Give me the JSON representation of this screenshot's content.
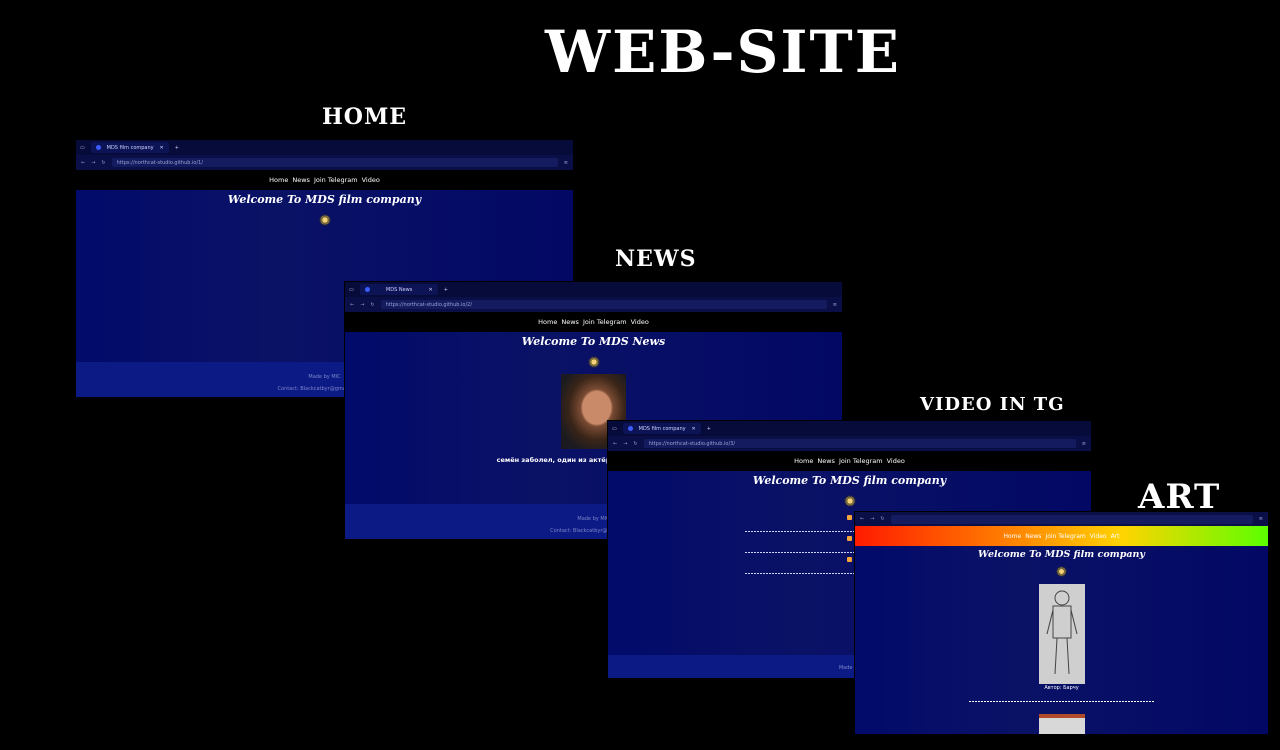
{
  "headings": {
    "main": "WEB-SITE",
    "home": "HOME",
    "news": "NEWS",
    "video": "VIDEO IN TG",
    "art": "ART"
  },
  "nav": [
    "Home",
    "News",
    "Join Telegram",
    "Video"
  ],
  "art_nav": [
    "Home",
    "News",
    "Join Telegram",
    "Video",
    "Art"
  ],
  "home_shot": {
    "tab_title": "MDS film company",
    "url": "https://northcat-studio.github.io/1/",
    "welcome": "Welcome To MDS film company",
    "footer_line1": "Made by MIC",
    "footer_line2": "Contact: Blackcatbyr@gmail.com | MI"
  },
  "news_shot": {
    "tab_title": "MDS News",
    "url": "https://northcat-studio.github.io/2/",
    "welcome": "Welcome To MDS News",
    "post_text": "семён заболел, один из актёров! 😷 Желаем выздо",
    "footer_line1": "Made by MIC",
    "footer_line2": "Contact: Blackcatbyr@gmail.com |"
  },
  "video_shot": {
    "tab_title": "MDS film company",
    "url": "https://northcat-studio.github.io/3/",
    "welcome": "Welcome To MDS film company",
    "footer_line1": "Made by"
  },
  "art_shot": {
    "welcome": "Welcome To MDS film company",
    "caption": "Автор: Барчу"
  },
  "colors": {
    "page_bg": "#000000",
    "site_bg": "#020864",
    "footer_bg": "#0c1a86"
  }
}
